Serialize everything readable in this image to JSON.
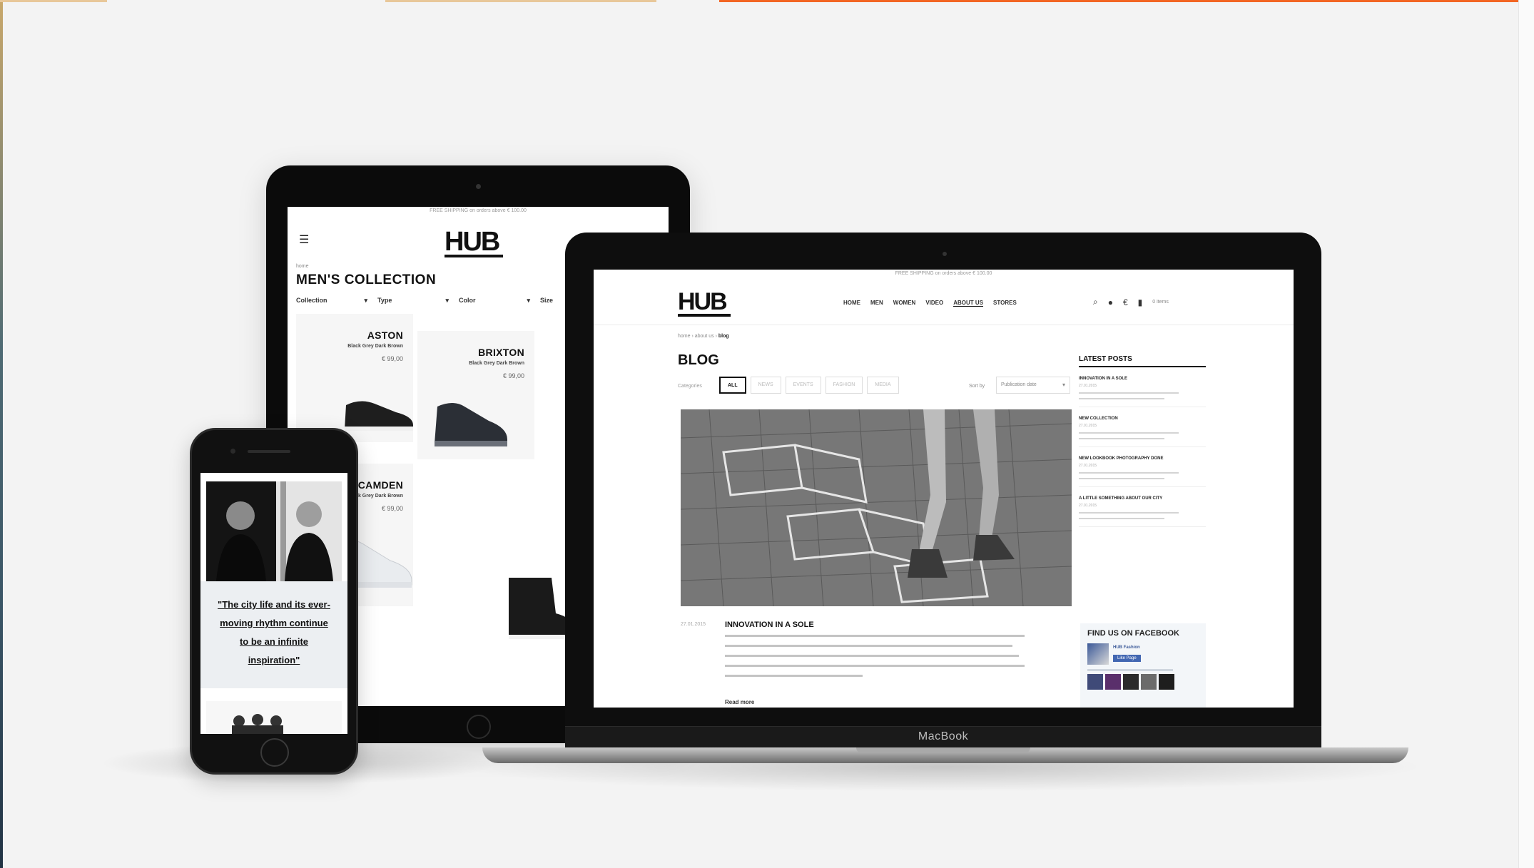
{
  "colors": {
    "accent_top": "#f26522",
    "dark": "#0e0e0e",
    "facebook": "#3b5998"
  },
  "tablet": {
    "shipping_note": "FREE SHIPPING on orders above € 100.00",
    "logo": "HUB",
    "menu_icon": "hamburger-icon",
    "breadcrumb": "home",
    "title": "MEN'S COLLECTION",
    "filters": [
      {
        "label": "Collection",
        "caret": "▾"
      },
      {
        "label": "Type",
        "caret": "▾"
      },
      {
        "label": "Color",
        "caret": "▾"
      },
      {
        "label": "Size",
        "caret": ""
      }
    ],
    "products": [
      {
        "name": "ASTON",
        "colors": "Black  Grey  Dark Brown",
        "price": "€ 99,00"
      },
      {
        "name": "BRIXTON",
        "colors": "Black  Grey  Dark Brown",
        "price": "€ 99,00"
      },
      {
        "name": "CAMDEN",
        "colors": "Black  Grey  Dark Brown",
        "price": "€ 99,00"
      }
    ]
  },
  "laptop": {
    "brand": "MacBook",
    "shipping_note": "FREE SHIPPING on orders above € 100.00",
    "logo": "HUB",
    "nav": [
      "HOME",
      "MEN",
      "WOMEN",
      "VIDEO",
      "ABOUT US",
      "STORES"
    ],
    "nav_active": "ABOUT US",
    "header_icons": [
      "search-icon",
      "user-icon",
      "euro-icon",
      "bag-icon"
    ],
    "icon_glyphs": {
      "search": "⌕",
      "user": "●",
      "euro": "€",
      "bag": "▮"
    },
    "cart_label": "0 items",
    "breadcrumb": {
      "home": "home",
      "sep1": "›",
      "about": "about us",
      "sep2": "›",
      "current": "blog"
    },
    "title": "BLOG",
    "category_label": "Categories",
    "categories": [
      "ALL",
      "NEWS",
      "EVENTS",
      "FASHION",
      "MEDIA"
    ],
    "category_active": "ALL",
    "sort_label": "Sort by",
    "sort_value": "Publication date",
    "post": {
      "date": "27.01.2015",
      "title": "INNOVATION IN A SOLE",
      "read_more": "Read more"
    },
    "sidebar": {
      "title": "LATEST POSTS",
      "items": [
        {
          "title": "INNOVATION IN A SOLE",
          "date": "27.01.2015"
        },
        {
          "title": "NEW COLLECTION",
          "date": "27.01.2015"
        },
        {
          "title": "NEW LOOKBOOK PHOTOGRAPHY DONE",
          "date": "27.01.2015"
        },
        {
          "title": "A LITTLE SOMETHING ABOUT OUR CITY",
          "date": "27.01.2015"
        }
      ]
    },
    "facebook": {
      "title": "FIND US ON FACEBOOK",
      "page_name": "HUB Fashion",
      "like_label": "Like Page"
    }
  },
  "phone": {
    "quote": "\"The city life and its ever-moving rhythm continue to be an infinite inspiration\""
  }
}
